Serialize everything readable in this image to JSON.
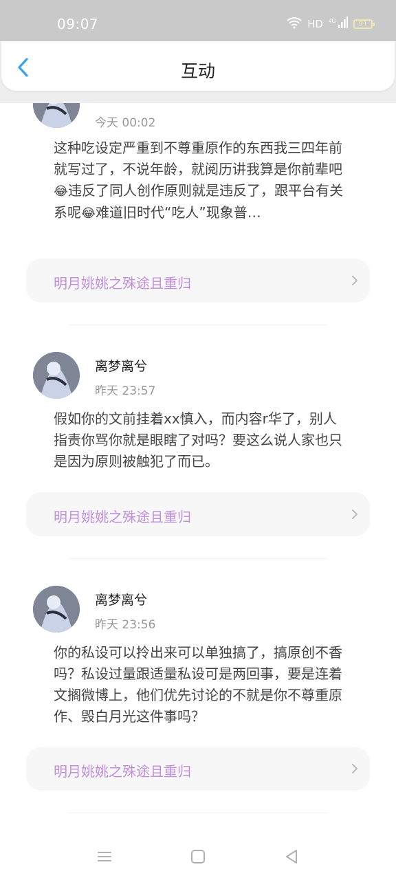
{
  "status_bar": {
    "time": "09:07",
    "network": "HD",
    "signal_label": "4G",
    "battery": "91",
    "icons": [
      "wifi-icon",
      "signal-icon",
      "battery-icon"
    ]
  },
  "header": {
    "title": "互动",
    "back_icon": "chevron-left-icon",
    "accent_color": "#3aa0f0"
  },
  "items": [
    {
      "username": "",
      "time": "今天 00:02",
      "comment_parts": [
        "这种吃设定严重到不尊重原作的东西我三四年前就写过了，不说年龄，就阅历讲我算是你前辈吧",
        "违反了同人创作原则就是违反了，跟平台有关系呢",
        "难道旧时代“吃人”现象普…"
      ],
      "emoji": "😂",
      "ref_title": "明月姚姚之殊途且重归"
    },
    {
      "username": "离梦离兮",
      "time": "昨天 23:57",
      "comment": "假如你的文前挂着xx慎入，而内容r华了，别人指责你骂你就是眼瞎了对吗？要这么说人家也只是因为原则被触犯了而已。",
      "ref_title": "明月姚姚之殊途且重归"
    },
    {
      "username": "离梦离兮",
      "time": "昨天 23:56",
      "comment": "你的私设可以拎出来可以单独搞了，搞原创不香吗？私设过量跟适量私设可是两回事，要是连着文搁微博上，他们优先讨论的不就是你不尊重原作、毁白月光这件事吗？",
      "ref_title": "明月姚姚之殊途且重归"
    }
  ],
  "colors": {
    "ref_text": "#c28fdc",
    "timestamp": "#999999"
  },
  "nav_bar": {
    "icons": [
      "menu-icon",
      "home-square-icon",
      "back-triangle-icon"
    ]
  }
}
